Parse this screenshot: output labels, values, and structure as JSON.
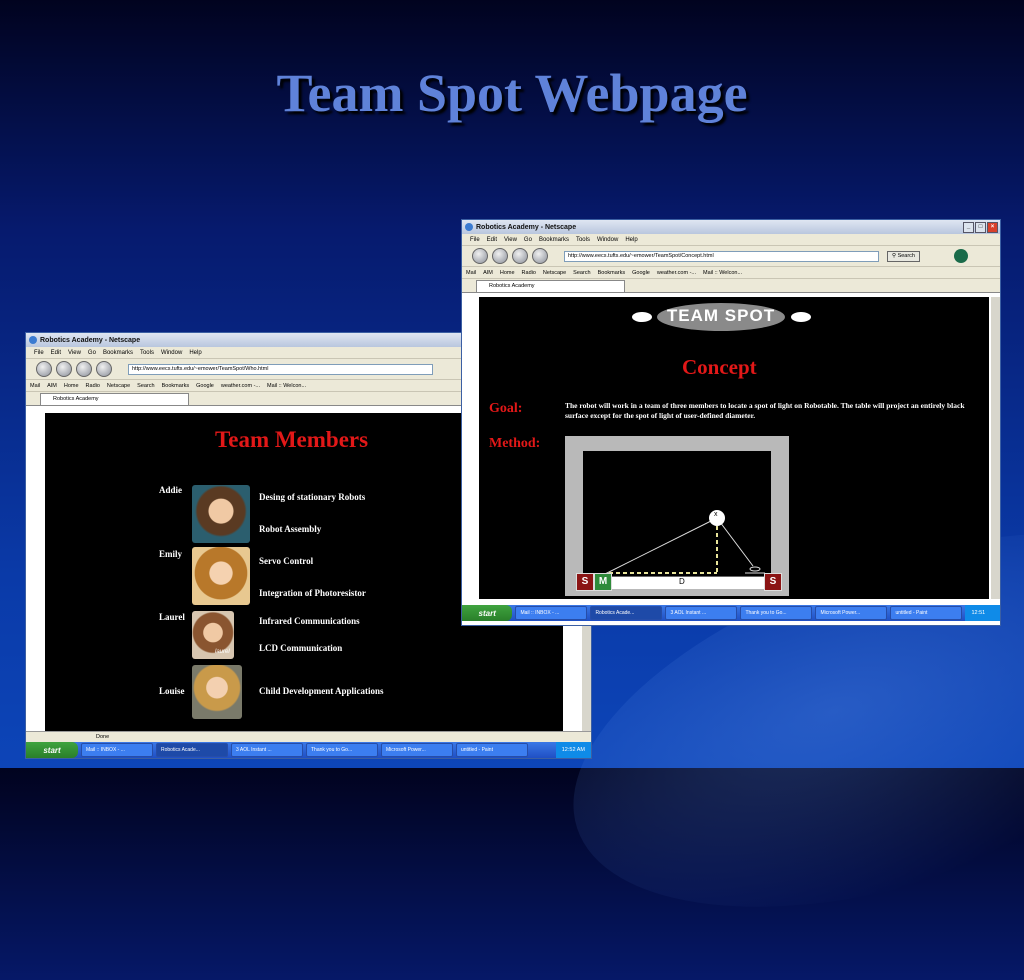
{
  "slide": {
    "title": "Team Spot Webpage"
  },
  "left_window": {
    "title": "Robotics Academy - Netscape",
    "menu": [
      "File",
      "Edit",
      "View",
      "Go",
      "Bookmarks",
      "Tools",
      "Window",
      "Help"
    ],
    "url": "http://www.eecs.tufts.edu/~emower/TeamSpot/Who.html",
    "personal": [
      "Mail",
      "AIM",
      "Home",
      "Radio",
      "Netscape",
      "Search",
      "Bookmarks",
      "Google",
      "weather.com -...",
      "Mail :: Welcon..."
    ],
    "tab": "Robotics Academy",
    "page_title": "Team Members",
    "members": [
      {
        "name": "Addie",
        "roles": [
          "Desing of stationary Robots",
          "Robot Assembly"
        ]
      },
      {
        "name": "Emily",
        "roles": [
          "Servo Control",
          "Integration of Photoresistor"
        ]
      },
      {
        "name": "Laurel",
        "roles": [
          "Infrared Communications",
          "LCD Communication"
        ]
      },
      {
        "name": "Louise",
        "roles": [
          "Child Development Applications"
        ]
      }
    ],
    "photo_caption": "laurel",
    "status": "Done",
    "start": "start",
    "tasks": [
      "Mail :: INBOX - ...",
      "Robotics Acade...",
      "3 AOL Instant ...",
      "Thank you to Go...",
      "Microsoft Power...",
      "untitled - Paint"
    ],
    "clock": "12:52 AM"
  },
  "right_window": {
    "title": "Robotics Academy - Netscape",
    "menu": [
      "File",
      "Edit",
      "View",
      "Go",
      "Bookmarks",
      "Tools",
      "Window",
      "Help"
    ],
    "url": "http://www.eecs.tufts.edu/~emower/TeamSpot/Concept.html",
    "search_label": "Search",
    "personal": [
      "Mail",
      "AIM",
      "Home",
      "Radio",
      "Netscape",
      "Search",
      "Bookmarks",
      "Google",
      "weather.com -...",
      "Mail :: Welcon..."
    ],
    "tab": "Robotics Academy",
    "logo_text": "TEAM SPOT",
    "page_title": "Concept",
    "goal_label": "Goal:",
    "goal_text": "The robot will work in a team of three members to locate a spot of light on Robotable. The table will project an entirely black surface except for the spot of light of user-defined diameter.",
    "method_label": "Method:",
    "diagram": {
      "s": "S",
      "m": "M",
      "d": "D",
      "x": "x"
    },
    "start": "start",
    "tasks": [
      "Mail :: INBOX - ...",
      "Robotics Acade...",
      "3 AOL Instant ...",
      "Thank you to Go...",
      "Microsoft Power...",
      "untitled - Paint"
    ],
    "clock": "12:51 AM"
  }
}
